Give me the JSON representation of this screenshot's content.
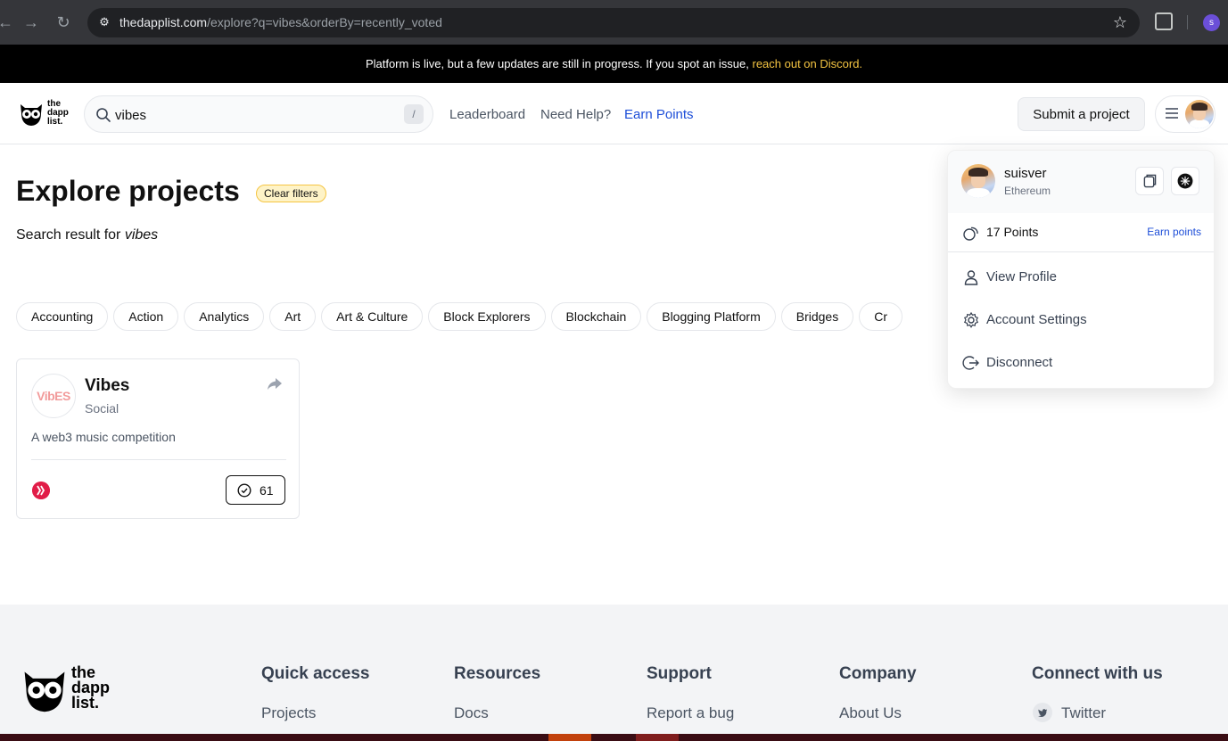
{
  "browser": {
    "url_host": "thedapplist.com",
    "url_path": "/explore?q=vibes&orderBy=recently_voted",
    "profile_initial": "s"
  },
  "banner": {
    "text": "Platform is live, but a few updates are still in progress. If you spot an issue, ",
    "link": "reach out on Discord."
  },
  "header": {
    "logo_text": [
      "the",
      "dapp",
      "list."
    ],
    "search_value": "vibes",
    "search_shortcut": "/",
    "nav": [
      "Leaderboard",
      "Need Help?",
      "Earn Points"
    ],
    "submit_label": "Submit a project"
  },
  "main": {
    "title": "Explore projects",
    "clear_filters": "Clear filters",
    "result_prefix": "Search result for ",
    "result_query": "vibes",
    "categories": [
      "Accounting",
      "Action",
      "Analytics",
      "Art",
      "Art & Culture",
      "Block Explorers",
      "Blockchain",
      "Blogging Platform",
      "Bridges",
      "Cr"
    ]
  },
  "project": {
    "logo_text": "VibES",
    "name": "Vibes",
    "category": "Social",
    "description": "A web3 music competition",
    "votes": "61"
  },
  "dropdown": {
    "username": "suisver",
    "network": "Ethereum",
    "points": "17 Points",
    "earn_points": "Earn points",
    "items": [
      "View Profile",
      "Account Settings",
      "Disconnect"
    ]
  },
  "footer": {
    "logo_text": [
      "the",
      "dapp",
      "list."
    ],
    "columns": [
      {
        "heading": "Quick access",
        "link": "Projects"
      },
      {
        "heading": "Resources",
        "link": "Docs"
      },
      {
        "heading": "Support",
        "link": "Report a bug"
      },
      {
        "heading": "Company",
        "link": "About Us"
      },
      {
        "heading": "Connect with us",
        "link": "Twitter"
      }
    ]
  },
  "colors": {
    "accent_blue": "#1d4ed8",
    "banner_link": "#f5c542",
    "chain_icon": "#e11d48"
  }
}
